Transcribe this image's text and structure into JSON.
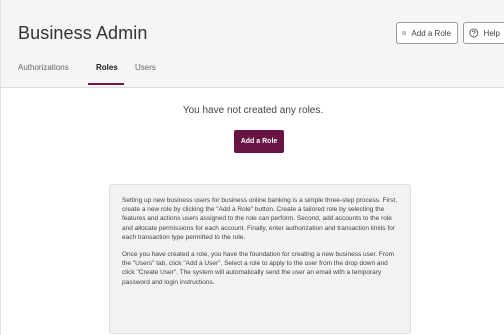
{
  "header": {
    "title": "Business Admin",
    "add_role_label": "Add a Role",
    "help_label": "Help"
  },
  "tabs": [
    {
      "label": "Authorizations",
      "active": false
    },
    {
      "label": "Roles",
      "active": true
    },
    {
      "label": "Users",
      "active": false
    }
  ],
  "main": {
    "empty_message": "You have not created any roles.",
    "add_role_button": "Add a Role",
    "info_paragraph_1": "Setting up new business users for business online banking is a simple three-step process. First, create a new role by clicking the \"Add a Role\" button. Create a tailored role by selecting the features and actions users assigned to the role can perform. Second, add accounts to the role and allocate permissions for each account. Finally, enter authorization and transaction limits for each transaction type permitted to the role.",
    "info_paragraph_2": "Once you have created a role, you have the foundation for creating a new business user. From the \"Users\" tab, click \"Add a User\". Select a role to apply to the user from the drop down and click \"Create User\". The system will automatically send the user an email with a temporary password and login instructions."
  },
  "colors": {
    "accent": "#681445",
    "tab_underline": "#7a1742"
  },
  "icons": {
    "add_role": "plus-circle-icon",
    "help": "question-circle-icon"
  }
}
